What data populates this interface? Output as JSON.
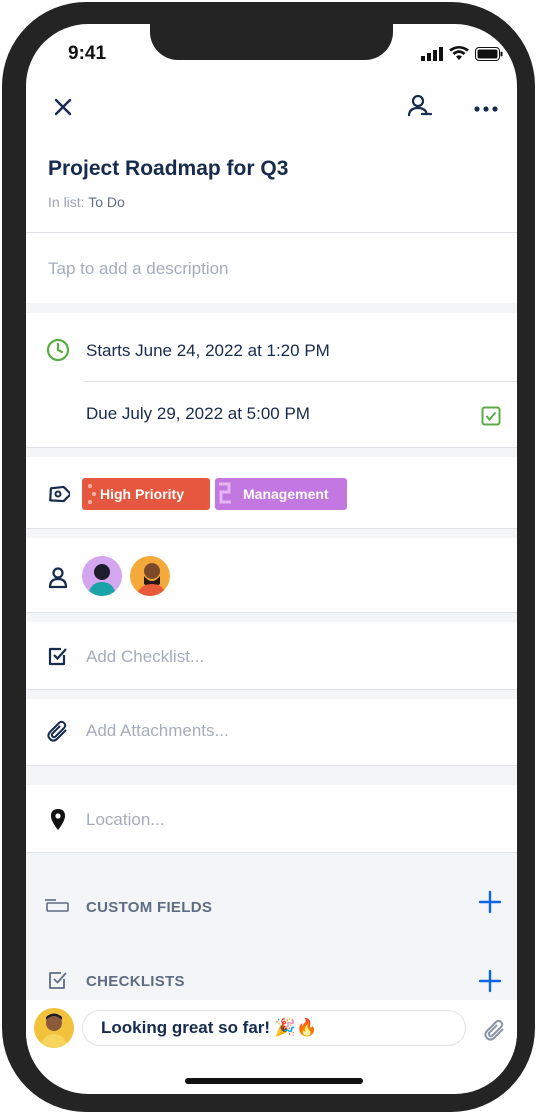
{
  "status_bar": {
    "time": "9:41"
  },
  "card": {
    "title": "Project Roadmap for Q3",
    "in_list_prefix": "In list:",
    "in_list_value": "To Do",
    "description_placeholder": "Tap to add a description"
  },
  "dates": {
    "start": "Starts June 24, 2022 at 1:20 PM",
    "due": "Due July 29, 2022 at 5:00 PM",
    "due_complete": true
  },
  "labels": [
    {
      "text": "High Priority",
      "color": "#e5573e"
    },
    {
      "text": "Management",
      "color": "#c377e0"
    }
  ],
  "members": [
    "member-1",
    "member-2"
  ],
  "checklist": {
    "placeholder": "Add Checklist..."
  },
  "attachments": {
    "placeholder": "Add Attachments..."
  },
  "location": {
    "placeholder": "Location..."
  },
  "sections": {
    "custom_fields": "CUSTOM FIELDS",
    "checklists": "CHECKLISTS"
  },
  "comment": {
    "text": "Looking great so far! 🎉🔥"
  },
  "colors": {
    "accent_green": "#5aac44",
    "accent_blue": "#0c66e4",
    "text_primary": "#172b4d",
    "text_muted": "#a5adba"
  }
}
